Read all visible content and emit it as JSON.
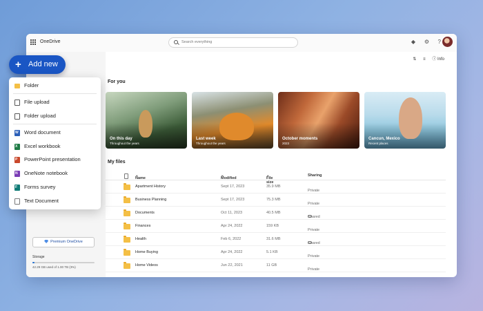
{
  "app": {
    "title": "OneDrive"
  },
  "search": {
    "placeholder": "Search everything"
  },
  "toolbar": {
    "info_label": "Info"
  },
  "sidebar": {
    "premium_label": "Premium OneDrive",
    "storage": {
      "label": "Storage",
      "detail": "42.29 GB used of 1.00 TB (3%)",
      "used_fraction": 0.03
    }
  },
  "add_new": {
    "label": "Add new"
  },
  "menu": {
    "items": [
      {
        "label": "Folder",
        "icon": "folder-icon"
      },
      {
        "label": "File upload",
        "icon": "file-upload-icon"
      },
      {
        "label": "Folder upload",
        "icon": "folder-upload-icon"
      },
      {
        "label": "Word document",
        "icon": "word-icon"
      },
      {
        "label": "Excel workbook",
        "icon": "excel-icon"
      },
      {
        "label": "PowerPoint presentation",
        "icon": "powerpoint-icon"
      },
      {
        "label": "OneNote notebook",
        "icon": "onenote-icon"
      },
      {
        "label": "Forms survey",
        "icon": "forms-icon"
      },
      {
        "label": "Text Document",
        "icon": "text-document-icon"
      }
    ]
  },
  "for_you": {
    "title": "For you",
    "cards": [
      {
        "title": "On this day",
        "subtitle": "Throughout the years"
      },
      {
        "title": "Last week",
        "subtitle": "Throughout the years"
      },
      {
        "title": "October moments",
        "subtitle": "2023"
      },
      {
        "title": "Cancun, Mexico",
        "subtitle": "Recent places"
      }
    ]
  },
  "my_files": {
    "title": "My files",
    "columns": {
      "name": "Name",
      "modified": "Modified",
      "size": "File size",
      "sharing": "Sharing"
    },
    "rows": [
      {
        "name": "Apartment History",
        "modified": "Sept 17, 2023",
        "size": "35.9 MB",
        "sharing": "Private"
      },
      {
        "name": "Business Planning",
        "modified": "Sept 17, 2023",
        "size": "75.3 MB",
        "sharing": "Private"
      },
      {
        "name": "Documents",
        "modified": "Oct 11, 2023",
        "size": "40.5 MB",
        "sharing": "Shared"
      },
      {
        "name": "Finances",
        "modified": "Apr 24, 2022",
        "size": "159 KB",
        "sharing": "Private"
      },
      {
        "name": "Health",
        "modified": "Feb 6, 2022",
        "size": "31.6 MB",
        "sharing": "Shared"
      },
      {
        "name": "Home Buying",
        "modified": "Apr 24, 2022",
        "size": "5.1 KB",
        "sharing": "Private"
      },
      {
        "name": "Home Videos",
        "modified": "Jun 22, 2021",
        "size": "11 GB",
        "sharing": "Private"
      }
    ]
  }
}
